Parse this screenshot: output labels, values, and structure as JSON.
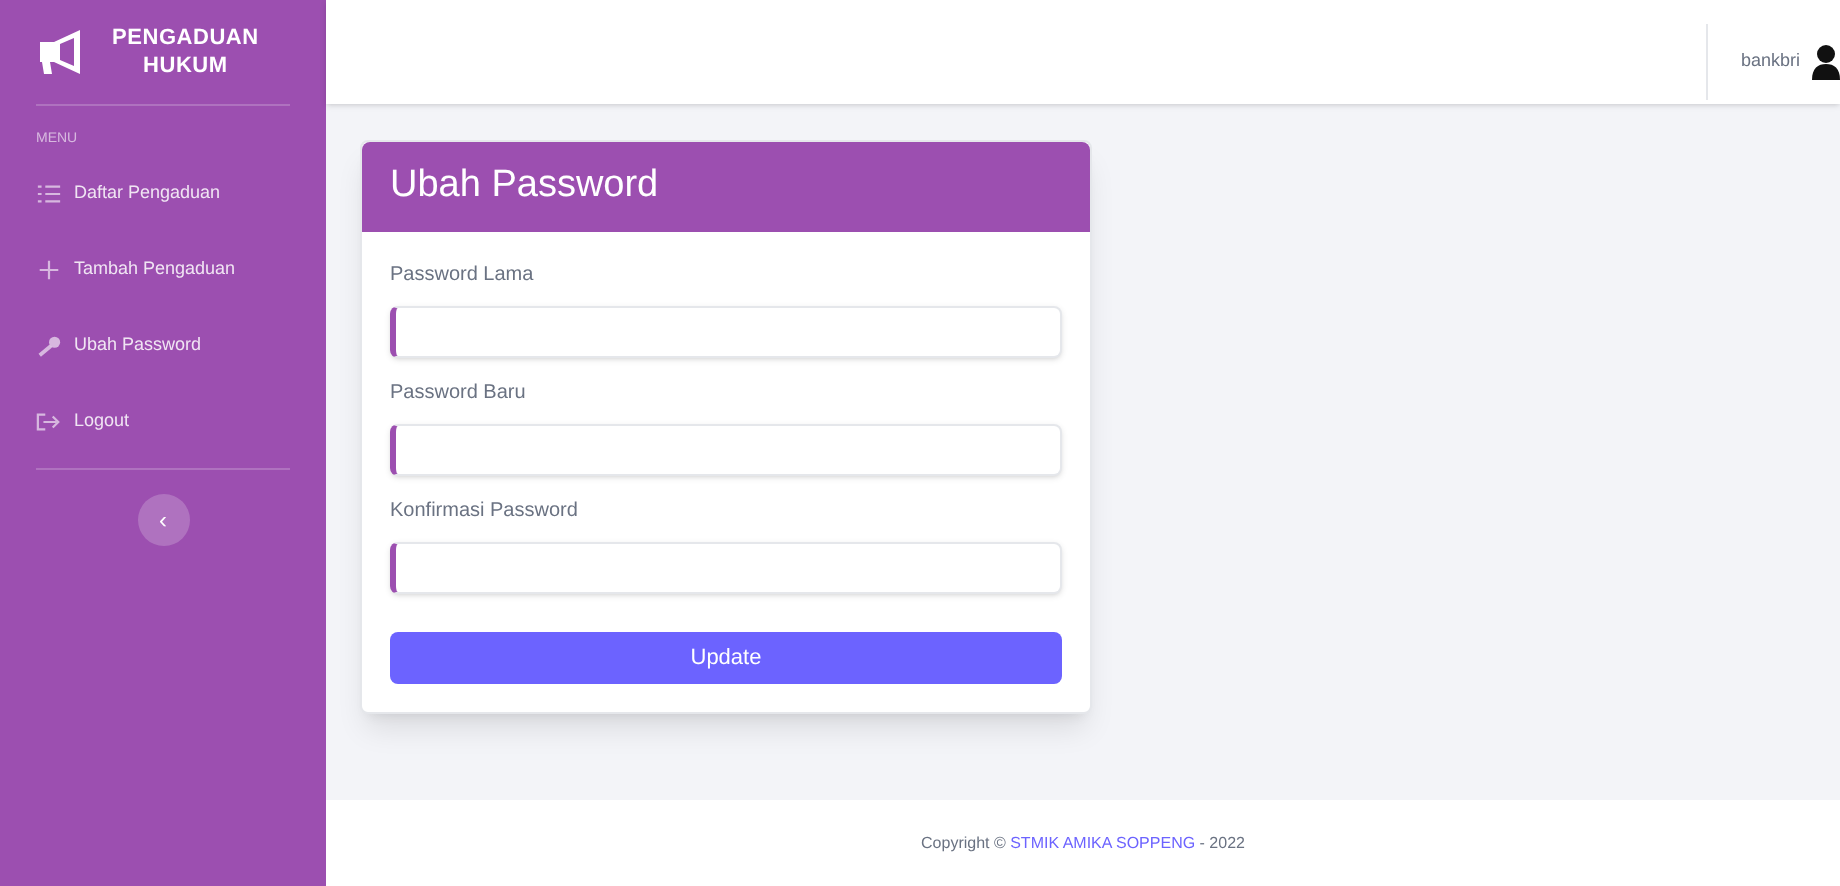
{
  "brand": {
    "line_1": "PENGADUAN",
    "line_2": "HUKUM"
  },
  "sidebar": {
    "heading": "MENU",
    "items": [
      {
        "label": "Daftar Pengaduan"
      },
      {
        "label": "Tambah Pengaduan"
      },
      {
        "label": "Ubah Password"
      },
      {
        "label": "Logout"
      }
    ],
    "toggle": "‹"
  },
  "topbar": {
    "user": "bankbri"
  },
  "card": {
    "title": "Ubah Password",
    "fields": [
      {
        "label": "Password Lama"
      },
      {
        "label": "Password Baru"
      },
      {
        "label": "Konfirmasi Password"
      }
    ],
    "button": "Update"
  },
  "footer": {
    "prefix": "Copyright © ",
    "link": "STMIK AMIKA SOPPENG",
    "suffix": " - 2022"
  }
}
